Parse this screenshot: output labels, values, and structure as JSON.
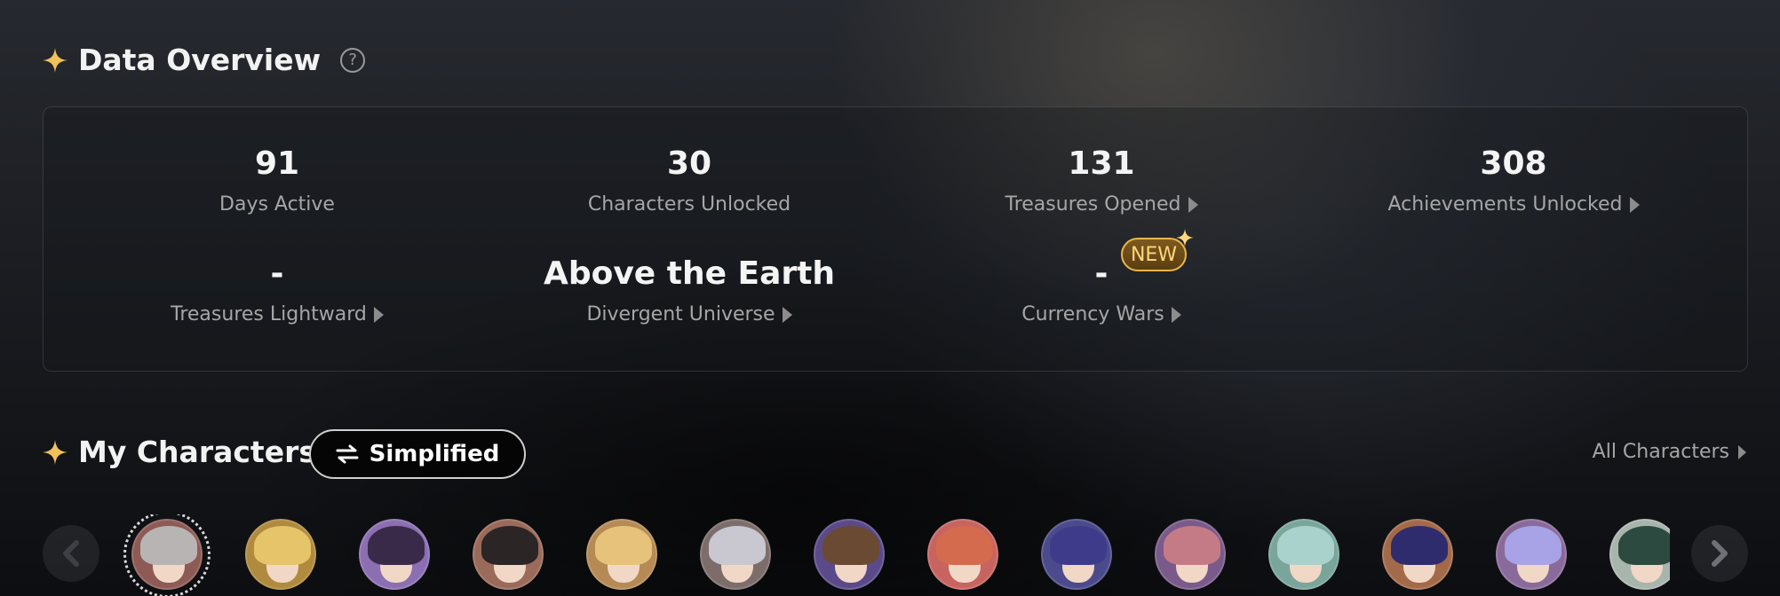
{
  "overview": {
    "title": "Data Overview",
    "help_icon": "question-circle-icon",
    "stats": [
      {
        "value": "91",
        "label": "Days Active",
        "has_arrow": false
      },
      {
        "value": "30",
        "label": "Characters Unlocked",
        "has_arrow": false
      },
      {
        "value": "131",
        "label": "Treasures Opened",
        "has_arrow": true
      },
      {
        "value": "308",
        "label": "Achievements Unlocked",
        "has_arrow": true
      },
      {
        "value": "-",
        "label": "Treasures Lightward",
        "has_arrow": true
      },
      {
        "value": "Above the Earth",
        "label": "Divergent Universe",
        "has_arrow": true
      },
      {
        "value": "-",
        "label": "Currency Wars",
        "has_arrow": true
      }
    ],
    "new_badge": "NEW"
  },
  "characters": {
    "title": "My Characters",
    "toggle_label": "Simplified",
    "all_link": "All Characters",
    "avatars": [
      {
        "hair": "#b9b4b4",
        "bg": "#8e5a55",
        "selected": true
      },
      {
        "hair": "#e6c46a",
        "bg": "#b08a3e"
      },
      {
        "hair": "#3a2a4a",
        "bg": "#8b6fb2"
      },
      {
        "hair": "#2b2526",
        "bg": "#9a6a5a"
      },
      {
        "hair": "#e6c27a",
        "bg": "#b58a55"
      },
      {
        "hair": "#c9c7cf",
        "bg": "#7c6d6a"
      },
      {
        "hair": "#6b4a33",
        "bg": "#5b4a8a"
      },
      {
        "hair": "#d46a4e",
        "bg": "#c76460"
      },
      {
        "hair": "#3e3c8a",
        "bg": "#4b4a8c"
      },
      {
        "hair": "#c57b86",
        "bg": "#7a5a8a"
      },
      {
        "hair": "#a9d2cc",
        "bg": "#7aa59a"
      },
      {
        "hair": "#2f2c6e",
        "bg": "#a36a4a"
      },
      {
        "hair": "#a8a2e6",
        "bg": "#8a6a9a"
      },
      {
        "hair": "#2d4a40",
        "bg": "#a8b5ad"
      }
    ]
  },
  "colors": {
    "accent": "#f1c15a",
    "label": "#a6a6a6"
  }
}
